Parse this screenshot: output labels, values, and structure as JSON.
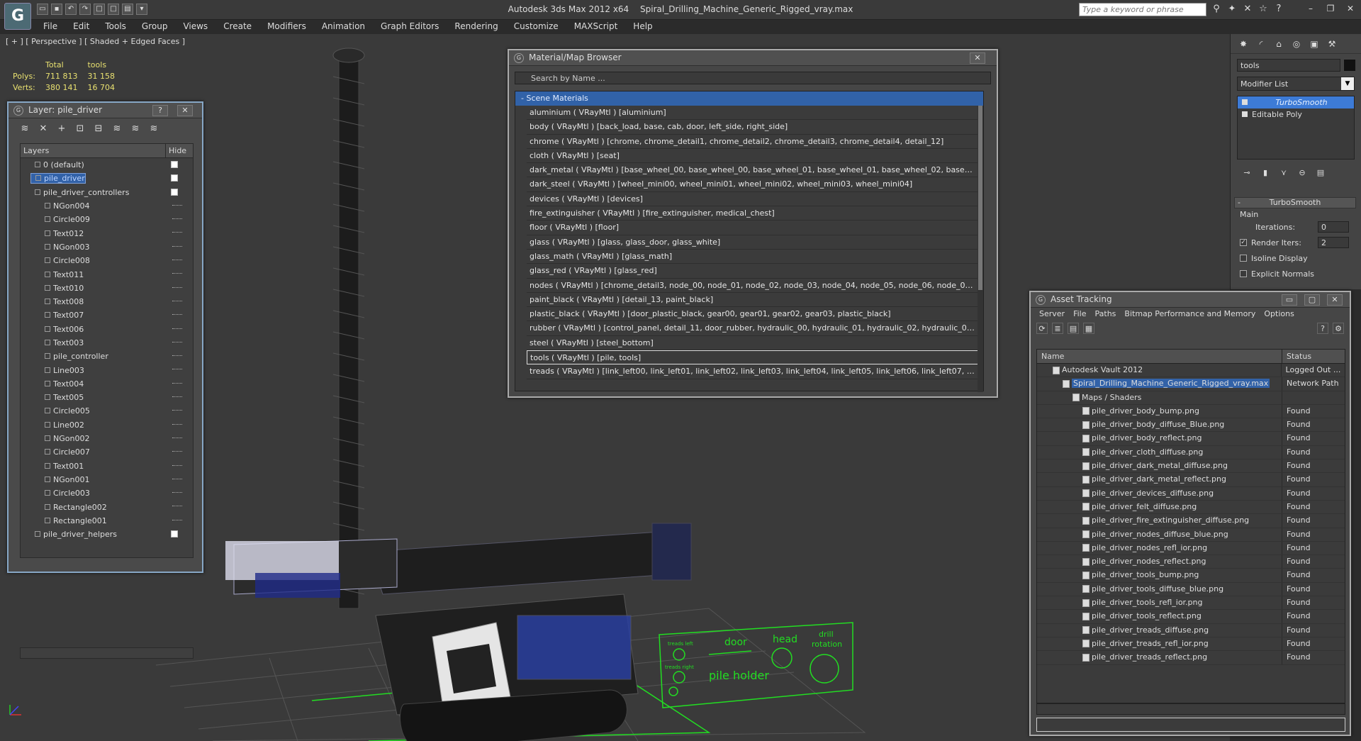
{
  "app": {
    "logo": "G",
    "title_app": "Autodesk 3ds Max  2012 x64",
    "title_file": "Spiral_Drilling_Machine_Generic_Rigged_vray.max",
    "search_placeholder": "Type a keyword or phrase"
  },
  "menu": [
    "File",
    "Edit",
    "Tools",
    "Group",
    "Views",
    "Create",
    "Modifiers",
    "Animation",
    "Graph Editors",
    "Rendering",
    "Customize",
    "MAXScript",
    "Help"
  ],
  "viewport": {
    "label": "[ + ] [ Perspective ] [ Shaded + Edged Faces ]",
    "stats": {
      "col_total": "Total",
      "col_tools": "tools",
      "polys_label": "Polys:",
      "polys_total": "711 813",
      "polys_tools": "31 158",
      "verts_label": "Verts:",
      "verts_total": "380 141",
      "verts_tools": "16 704"
    },
    "panel_labels": {
      "treads_left": "treads left",
      "door": "door",
      "head": "head",
      "drill_rotation_1": "drill",
      "drill_rotation_2": "rotation",
      "treads_right": "treads right",
      "pile_holder": "pile holder"
    }
  },
  "layer_window": {
    "title": "Layer: pile_driver",
    "help_btn": "?",
    "close_btn": "✕",
    "col_layers": "Layers",
    "col_hide": "Hide",
    "rows": [
      {
        "name": "0 (default)",
        "indent": 1,
        "type": "layer"
      },
      {
        "name": "pile_driver",
        "indent": 1,
        "type": "layer",
        "selected": true
      },
      {
        "name": "pile_driver_controllers",
        "indent": 1,
        "type": "layer"
      },
      {
        "name": "NGon004",
        "indent": 2,
        "type": "object"
      },
      {
        "name": "Circle009",
        "indent": 2,
        "type": "object"
      },
      {
        "name": "Text012",
        "indent": 2,
        "type": "object"
      },
      {
        "name": "NGon003",
        "indent": 2,
        "type": "object"
      },
      {
        "name": "Circle008",
        "indent": 2,
        "type": "object"
      },
      {
        "name": "Text011",
        "indent": 2,
        "type": "object"
      },
      {
        "name": "Text010",
        "indent": 2,
        "type": "object"
      },
      {
        "name": "Text008",
        "indent": 2,
        "type": "object"
      },
      {
        "name": "Text007",
        "indent": 2,
        "type": "object"
      },
      {
        "name": "Text006",
        "indent": 2,
        "type": "object"
      },
      {
        "name": "Text003",
        "indent": 2,
        "type": "object"
      },
      {
        "name": "pile_controller",
        "indent": 2,
        "type": "object"
      },
      {
        "name": "Line003",
        "indent": 2,
        "type": "object"
      },
      {
        "name": "Text004",
        "indent": 2,
        "type": "object"
      },
      {
        "name": "Text005",
        "indent": 2,
        "type": "object"
      },
      {
        "name": "Circle005",
        "indent": 2,
        "type": "object"
      },
      {
        "name": "Line002",
        "indent": 2,
        "type": "object"
      },
      {
        "name": "NGon002",
        "indent": 2,
        "type": "object"
      },
      {
        "name": "Circle007",
        "indent": 2,
        "type": "object"
      },
      {
        "name": "Text001",
        "indent": 2,
        "type": "object"
      },
      {
        "name": "NGon001",
        "indent": 2,
        "type": "object"
      },
      {
        "name": "Circle003",
        "indent": 2,
        "type": "object"
      },
      {
        "name": "Rectangle002",
        "indent": 2,
        "type": "object"
      },
      {
        "name": "Rectangle001",
        "indent": 2,
        "type": "object"
      },
      {
        "name": "pile_driver_helpers",
        "indent": 1,
        "type": "layer"
      }
    ]
  },
  "material_browser": {
    "title": "Material/Map Browser",
    "close_btn": "✕",
    "search_placeholder": "Search by Name ...",
    "section": "- Scene Materials",
    "rows": [
      "aluminium  ( VRayMtl ) [aluminium]",
      "body  ( VRayMtl ) [back_load, base, cab, door, left_side, right_side]",
      "chrome  ( VRayMtl ) [chrome, chrome_detail1, chrome_detail2, chrome_detail3, chrome_detail4, detail_12]",
      "cloth  ( VRayMtl ) [seat]",
      "dark_metal  ( VRayMtl ) [base_wheel_00, base_wheel_00, base_wheel_01, base_wheel_01, base_wheel_02, base_wheel_...",
      "dark_steel  ( VRayMtl ) [wheel_mini00, wheel_mini01, wheel_mini02, wheel_mini03, wheel_mini04]",
      "devices  ( VRayMtl ) [devices]",
      "fire_extinguisher  ( VRayMtl ) [fire_extinguisher, medical_chest]",
      "floor  ( VRayMtl ) [floor]",
      "glass  ( VRayMtl ) [glass, glass_door, glass_white]",
      "glass_math  ( VRayMtl ) [glass_math]",
      "glass_red  ( VRayMtl ) [glass_red]",
      "nodes  ( VRayMtl ) [chrome_detail3, node_00, node_01, node_02, node_03, node_04, node_05, node_06, node_07, node...",
      "paint_black  ( VRayMtl ) [detail_13, paint_black]",
      "plastic_black  ( VRayMtl ) [door_plastic_black, gear00, gear01, gear02, gear03, plastic_black]",
      "rubber  ( VRayMtl ) [control_panel, detail_11, door_rubber, hydraulic_00, hydraulic_01, hydraulic_02, hydraulic_03, hydra...",
      "steel  ( VRayMtl ) [steel_bottom]",
      "tools  ( VRayMtl ) [pile, tools]",
      "treads  ( VRayMtl ) [link_left00, link_left01, link_left02, link_left03, link_left04, link_left05, link_left06, link_left07, link_left..."
    ],
    "selected_index": 17
  },
  "asset_tracking": {
    "title": "Asset Tracking",
    "min_btn": "▭",
    "max_btn": "▢",
    "close_btn": "✕",
    "menu": [
      "Server",
      "File",
      "Paths",
      "Bitmap Performance and Memory",
      "Options"
    ],
    "col_name": "Name",
    "col_status": "Status",
    "rows": [
      {
        "name": "Autodesk Vault 2012",
        "status": "Logged Out ...",
        "indent": 1
      },
      {
        "name": "Spiral_Drilling_Machine_Generic_Rigged_vray.max",
        "status": "Network Path",
        "indent": 2,
        "selected": true
      },
      {
        "name": "Maps / Shaders",
        "status": "",
        "indent": 3
      },
      {
        "name": "pile_driver_body_bump.png",
        "status": "Found",
        "indent": 4
      },
      {
        "name": "pile_driver_body_diffuse_Blue.png",
        "status": "Found",
        "indent": 4
      },
      {
        "name": "pile_driver_body_reflect.png",
        "status": "Found",
        "indent": 4
      },
      {
        "name": "pile_driver_cloth_diffuse.png",
        "status": "Found",
        "indent": 4
      },
      {
        "name": "pile_driver_dark_metal_diffuse.png",
        "status": "Found",
        "indent": 4
      },
      {
        "name": "pile_driver_dark_metal_reflect.png",
        "status": "Found",
        "indent": 4
      },
      {
        "name": "pile_driver_devices_diffuse.png",
        "status": "Found",
        "indent": 4
      },
      {
        "name": "pile_driver_felt_diffuse.png",
        "status": "Found",
        "indent": 4
      },
      {
        "name": "pile_driver_fire_extinguisher_diffuse.png",
        "status": "Found",
        "indent": 4
      },
      {
        "name": "pile_driver_nodes_diffuse_blue.png",
        "status": "Found",
        "indent": 4
      },
      {
        "name": "pile_driver_nodes_refl_ior.png",
        "status": "Found",
        "indent": 4
      },
      {
        "name": "pile_driver_nodes_reflect.png",
        "status": "Found",
        "indent": 4
      },
      {
        "name": "pile_driver_tools_bump.png",
        "status": "Found",
        "indent": 4
      },
      {
        "name": "pile_driver_tools_diffuse_blue.png",
        "status": "Found",
        "indent": 4
      },
      {
        "name": "pile_driver_tools_refl_ior.png",
        "status": "Found",
        "indent": 4
      },
      {
        "name": "pile_driver_tools_reflect.png",
        "status": "Found",
        "indent": 4
      },
      {
        "name": "pile_driver_treads_diffuse.png",
        "status": "Found",
        "indent": 4
      },
      {
        "name": "pile_driver_treads_refl_ior.png",
        "status": "Found",
        "indent": 4
      },
      {
        "name": "pile_driver_treads_reflect.png",
        "status": "Found",
        "indent": 4
      }
    ]
  },
  "command_panel": {
    "object_name": "tools",
    "modifier_list": "Modifier List",
    "stack": [
      {
        "name": "TurboSmooth",
        "selected": true
      },
      {
        "name": "Editable Poly",
        "selected": false
      }
    ],
    "rollout_title": "TurboSmooth",
    "rollout_minus": "-",
    "group_main": "Main",
    "iterations_label": "Iterations:",
    "iterations_value": "0",
    "render_iters_label": "Render Iters:",
    "render_iters_value": "2",
    "isoline_label": "Isoline Display",
    "explicit_normals_label": "Explicit Normals"
  },
  "colors": {
    "selection_blue": "#3262a8",
    "stats_yellow": "#e8e070",
    "wire_green": "#22dd22",
    "wire_blue": "#2a3fa0"
  }
}
